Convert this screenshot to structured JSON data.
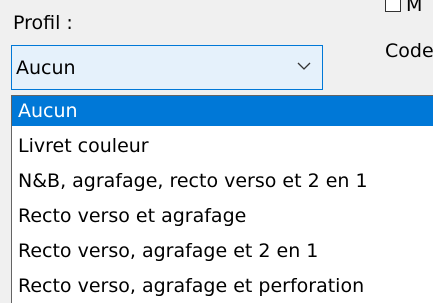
{
  "form": {
    "profile_label": "Profil :",
    "checkbox_label": "M",
    "code_label": "Code"
  },
  "combo": {
    "selected_value": "Aucun"
  },
  "dropdown": {
    "options": [
      "Aucun",
      "Livret couleur",
      "N&B, agrafage, recto verso et 2 en 1",
      "Recto verso et agrafage",
      "Recto verso, agrafage et 2 en 1",
      "Recto verso, agrafage et perforation"
    ],
    "highlighted_index": 0
  },
  "colors": {
    "highlight": "#0078d7",
    "combo_focus_bg": "#e5f1fb",
    "window_bg": "#f0f0f0"
  },
  "icons": {
    "combo_arrow": "chevron-down-icon"
  }
}
